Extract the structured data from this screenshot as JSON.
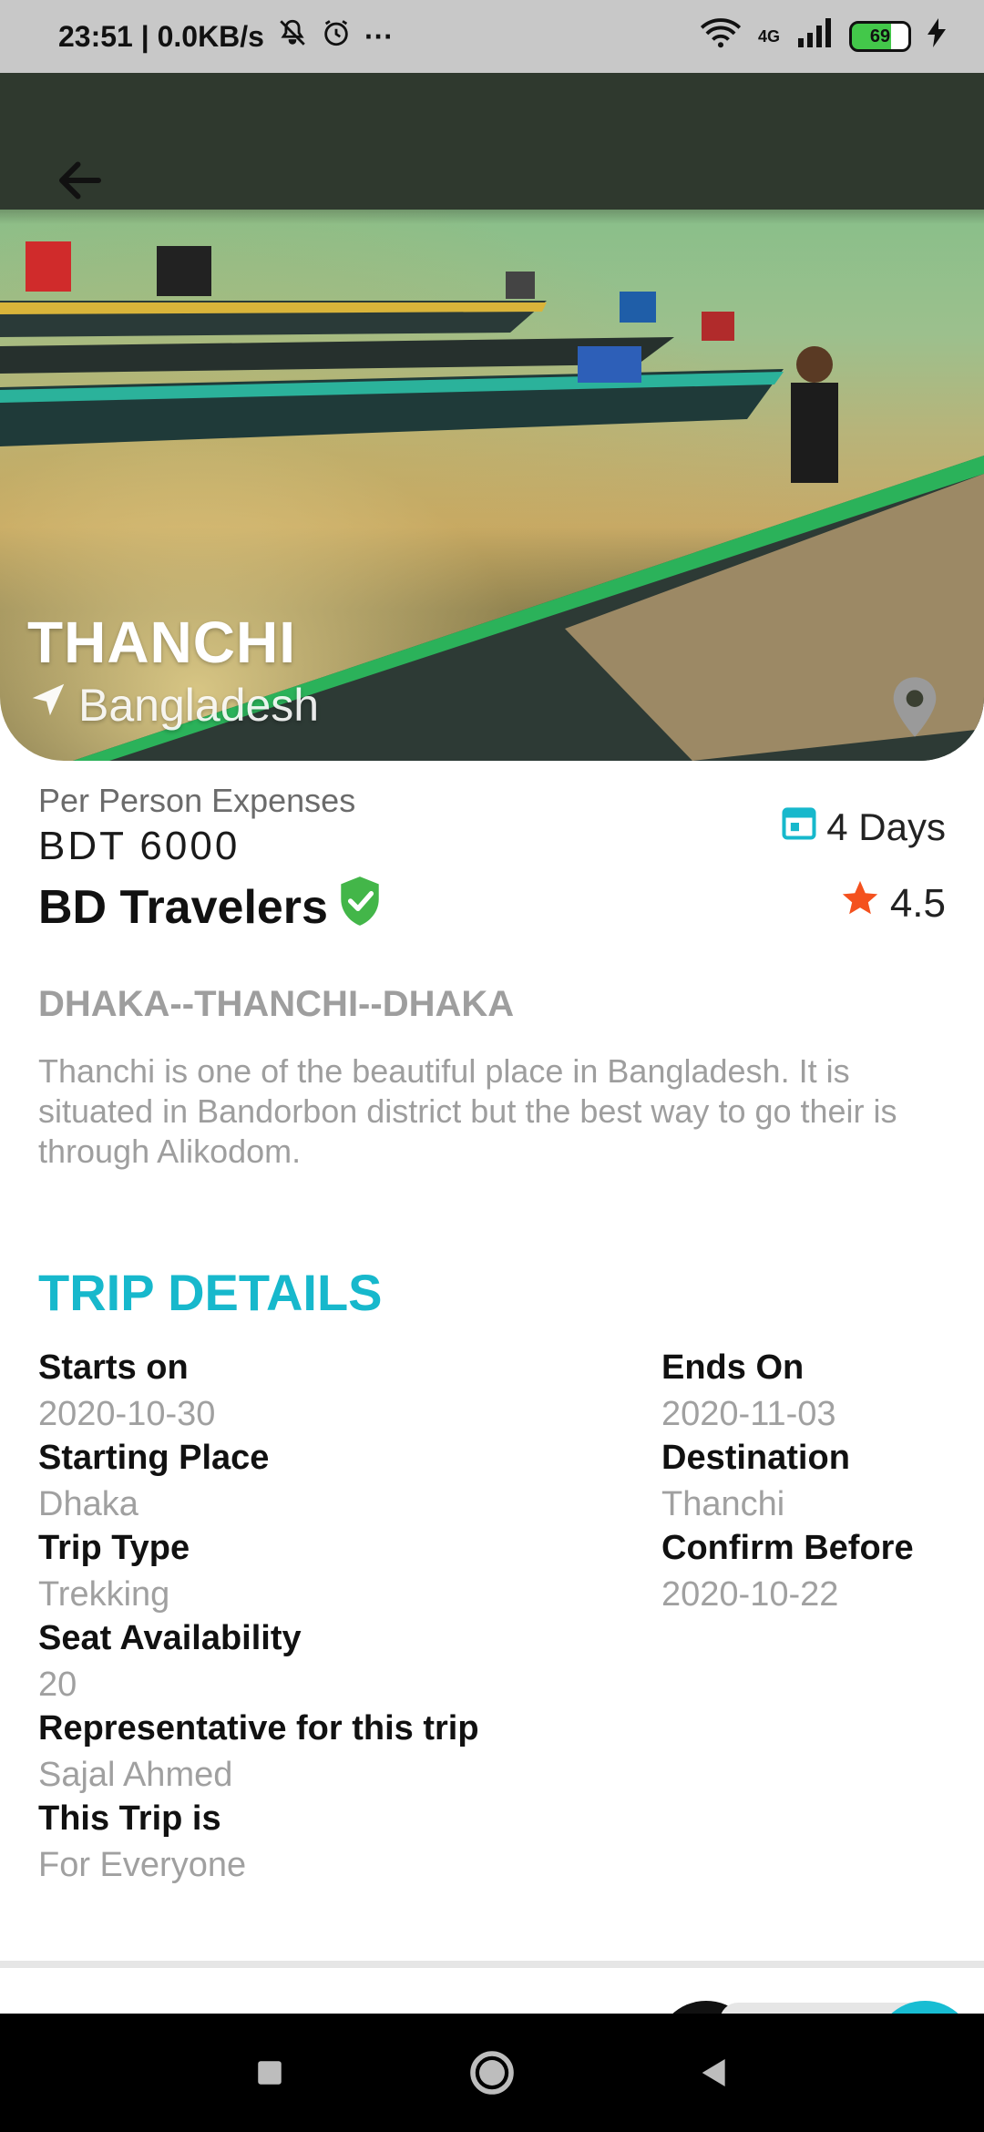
{
  "status_bar": {
    "time_speed": "23:51 | 0.0KB/s",
    "more": "···",
    "network_label": "4G",
    "battery_percent": "69"
  },
  "hero": {
    "title": "THANCHI",
    "subtitle": "Bangladesh"
  },
  "summary": {
    "expense_label": "Per Person Expenses",
    "price": "BDT 6000",
    "agency": "BD Travelers",
    "days": "4 Days",
    "rating": "4.5"
  },
  "route": "DHAKA--THANCHI--DHAKA",
  "description": "Thanchi is one of the beautiful place in Bangladesh. It is situated in Bandorbon district but the best way to go their is through Alikodom.",
  "trip_details": {
    "title": "TRIP DETAILS",
    "starts_on": {
      "label": "Starts on",
      "value": "2020-10-30"
    },
    "ends_on": {
      "label": "Ends On",
      "value": "2020-11-03"
    },
    "starting_place": {
      "label": "Starting Place",
      "value": "Dhaka"
    },
    "destination": {
      "label": "Destination",
      "value": "Thanchi"
    },
    "trip_type": {
      "label": "Trip Type",
      "value": "Trekking"
    },
    "confirm_before": {
      "label": "Confirm Before",
      "value": "2020-10-22"
    },
    "seat_availability": {
      "label": "Seat Availability",
      "value": "20"
    },
    "representative": {
      "label": "Representative for this trip",
      "value": "Sajal Ahmed"
    },
    "audience": {
      "label": "This Trip is",
      "value": "For Everyone"
    }
  },
  "colors": {
    "accent": "#17b8cc",
    "verified": "#43b649",
    "star": "#f4511e",
    "muted_text": "#9e9e9e"
  }
}
